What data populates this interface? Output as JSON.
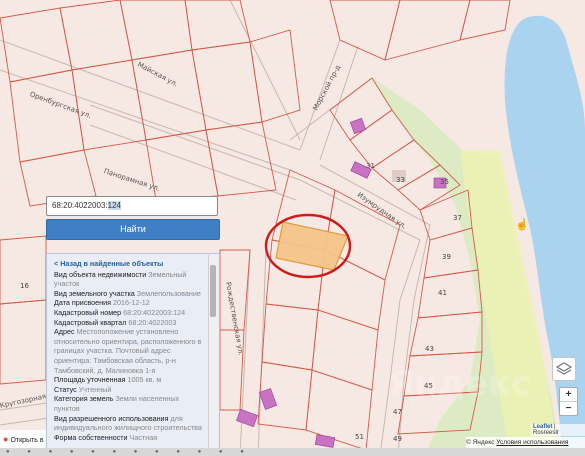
{
  "map": {
    "streets": [
      {
        "name": "Майская ул.",
        "kind": "street"
      },
      {
        "name": "Панорамная ул.",
        "kind": "street"
      },
      {
        "name": "Морской пр-д",
        "kind": "street"
      },
      {
        "name": "Оренбургская ул.",
        "kind": "street"
      },
      {
        "name": "Изумрудная ул.",
        "kind": "street"
      },
      {
        "name": "Рождественская ул.",
        "kind": "street"
      },
      {
        "name": "Кругозорная ул.",
        "kind": "street"
      }
    ],
    "plot_numbers": [
      "31",
      "33",
      "35",
      "37",
      "39",
      "41",
      "43",
      "45",
      "47",
      "49",
      "51",
      "16"
    ],
    "colors": {
      "map_bg": "#f6e8e2",
      "water": "#a9d3ef",
      "park": "#d9ebc0",
      "highlight_fill": "#f5c58a",
      "highlight_stroke": "#e09a36",
      "circle": "#cc1c1c",
      "building": "#c872c4"
    }
  },
  "search": {
    "value_prefix": "68:20:4022003:",
    "value_selected": "124",
    "find_label": "Найти"
  },
  "info": {
    "back_label": "< Назад в найденные объекты",
    "rows": [
      {
        "label": "Вид объекта недвижимости",
        "value": "Земельный участок"
      },
      {
        "label": "Вид земельного участка",
        "value": "Землепользование"
      },
      {
        "label": "Дата присвоения",
        "value": "2016-12-12"
      },
      {
        "label": "Кадастровый номер",
        "value": "68:20:4022003:124"
      },
      {
        "label": "Кадастровый квартал",
        "value": "68:20:4022003"
      },
      {
        "label": "Адрес",
        "value": "Местоположение установлено относительно ориентира, расположенного в границах участка. Почтовый адрес ориентира: Тамбовская область, р-н Тамбовский, д. Малиновка 1-я"
      },
      {
        "label": "Площадь уточненная",
        "value": "1005 кв. м"
      },
      {
        "label": "Статус",
        "value": "Учтенный"
      },
      {
        "label": "Категория земель",
        "value": "Земли населенных пунктов"
      },
      {
        "label": "Вид разрешенного использования",
        "value": "для индивидуального жилищного строительства"
      },
      {
        "label": "Форма собственности",
        "value": "Частная"
      }
    ]
  },
  "open_label": "Открыть в",
  "zoom": {
    "in": "+",
    "out": "−"
  },
  "attribution": {
    "leaflet": "Leaflet",
    "sep": " | ",
    "source": "Rosreestr"
  },
  "copyright": {
    "text": "© Яндекс",
    "terms": "Условия использования"
  },
  "watermark": "Яндекс"
}
